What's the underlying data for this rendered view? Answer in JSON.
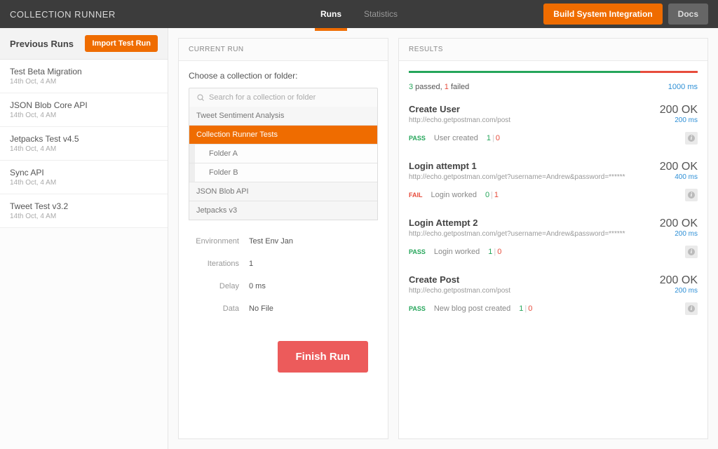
{
  "header": {
    "title": "COLLECTION RUNNER",
    "tabs": {
      "runs": "Runs",
      "stats": "Statistics"
    },
    "build_btn": "Build System Integration",
    "docs_btn": "Docs"
  },
  "sidebar": {
    "title": "Previous Runs",
    "import_btn": "Import Test Run",
    "runs": [
      {
        "name": "Test Beta Migration",
        "date": "14th Oct, 4 AM"
      },
      {
        "name": "JSON Blob Core API",
        "date": "14th Oct, 4 AM"
      },
      {
        "name": "Jetpacks Test v4.5",
        "date": "14th Oct, 4 AM"
      },
      {
        "name": "Sync API",
        "date": "14th Oct, 4 AM"
      },
      {
        "name": "Tweet Test v3.2",
        "date": "14th Oct, 4 AM"
      }
    ]
  },
  "current_run": {
    "title": "CURRENT RUN",
    "prompt": "Choose a collection or folder:",
    "search_placeholder": "Search for a collection or folder",
    "collections": {
      "tweet": "Tweet Sentiment Analysis",
      "runner": "Collection Runner Tests",
      "folder_a": "Folder A",
      "folder_b": "Folder B",
      "json_blob": "JSON Blob API",
      "jetpacks": "Jetpacks v3"
    },
    "settings": {
      "env_label": "Environment",
      "env_val": "Test Env Jan",
      "iter_label": "Iterations",
      "iter_val": "1",
      "delay_label": "Delay",
      "delay_val": "0  ms",
      "data_label": "Data",
      "data_val": "No File"
    },
    "finish_btn": "Finish Run"
  },
  "results": {
    "title": "RESULTS",
    "progress": {
      "pass_pct": 80,
      "fail_pct": 20
    },
    "summary": {
      "passed_n": "3",
      "passed_t": " passed",
      "failed_n": "1",
      "failed_t": " failed",
      "time": "1000 ms"
    },
    "items": [
      {
        "name": "Create User",
        "url": "http://echo.getpostman.com/post",
        "code": "200 OK",
        "time": "200 ms",
        "status": "PASS",
        "test_name": "User created",
        "pass": "1",
        "fail": "0"
      },
      {
        "name": "Login attempt 1",
        "url": "http://echo.getpostman.com/get?username=Andrew&password=******",
        "code": "200 OK",
        "time": "400 ms",
        "status": "FAIL",
        "test_name": "Login worked",
        "pass": "0",
        "fail": "1"
      },
      {
        "name": "Login Attempt 2",
        "url": "http://echo.getpostman.com/get?username=Andrew&password=******",
        "code": "200 OK",
        "time": "200 ms",
        "status": "PASS",
        "test_name": "Login worked",
        "pass": "1",
        "fail": "0"
      },
      {
        "name": "Create Post",
        "url": "http://echo.getpostman.com/post",
        "code": "200 OK",
        "time": "200 ms",
        "status": "PASS",
        "test_name": "New blog post created",
        "pass": "1",
        "fail": "0"
      }
    ]
  }
}
